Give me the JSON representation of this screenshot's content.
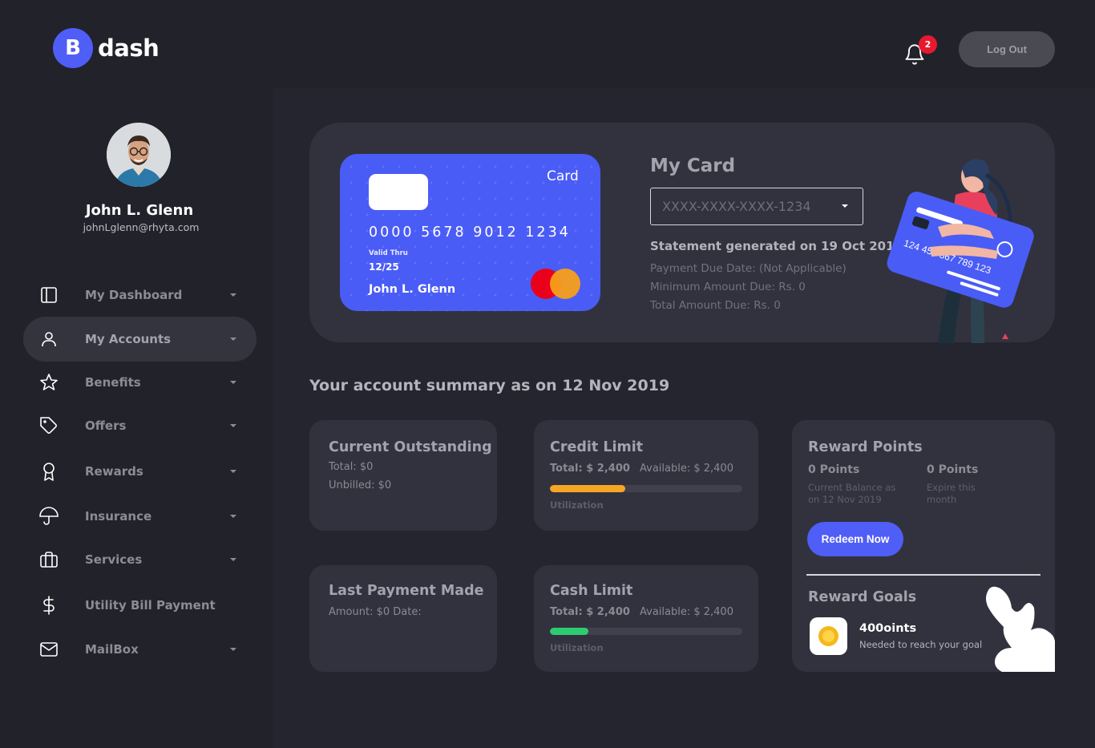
{
  "brand": {
    "mark": "B",
    "name": "dash"
  },
  "header": {
    "notification_count": "2",
    "logout_label": "Log Out"
  },
  "user": {
    "name": "John L. Glenn",
    "email": "johnLglenn@rhyta.com"
  },
  "sidebar": {
    "items": [
      {
        "label": "My Dashboard",
        "icon": "dashboard-icon",
        "has_caret": true,
        "active": false
      },
      {
        "label": "My Accounts",
        "icon": "user-icon",
        "has_caret": true,
        "active": true
      },
      {
        "label": "Benefits",
        "icon": "star-icon",
        "has_caret": true,
        "active": false
      },
      {
        "label": "Offers",
        "icon": "tag-icon",
        "has_caret": true,
        "active": false
      },
      {
        "label": "Rewards",
        "icon": "award-icon",
        "has_caret": true,
        "active": false
      },
      {
        "label": "Insurance",
        "icon": "umbrella-icon",
        "has_caret": true,
        "active": false
      },
      {
        "label": "Services",
        "icon": "briefcase-icon",
        "has_caret": true,
        "active": false
      },
      {
        "label": "Utility Bill Payment",
        "icon": "dollar-icon",
        "has_caret": false,
        "active": false
      },
      {
        "label": "MailBox",
        "icon": "mail-icon",
        "has_caret": true,
        "active": false
      }
    ]
  },
  "credit_card": {
    "label": "Card",
    "number": "0000 5678 9012 1234",
    "valid_thru_label": "Valid Thru",
    "valid_thru": "12/25",
    "holder": "John L. Glenn"
  },
  "my_card": {
    "title": "My Card",
    "select_value": "XXXX-XXXX-XXXX-1234",
    "statement": "Statement generated on 19 Oct 2019",
    "payment_due": "Payment Due Date: (Not Applicable)",
    "minimum_due": "Minimum Amount Due: Rs. 0",
    "total_due": "Total Amount Due: Rs. 0",
    "illustration_card_number": "124 456 367 789 123"
  },
  "summary": {
    "title": "Your account summary as on 12 Nov 2019",
    "current_outstanding": {
      "title": "Current Outstanding",
      "total": "Total: $0",
      "unbilled": "Unbilled: $0"
    },
    "credit_limit": {
      "title": "Credit Limit",
      "total": "Total: $ 2,400",
      "available": "Available: $ 2,400",
      "utilization_label": "Utilization",
      "utilization": 0.39,
      "bar_color": "#f5a623"
    },
    "last_payment": {
      "title": "Last Payment Made",
      "amount": "Amount: $0 Date:"
    },
    "cash_limit": {
      "title": "Cash Limit",
      "total": "Total: $ 2,400",
      "available": "Available: $ 2,400",
      "utilization_label": "Utilization",
      "utilization": 0.2,
      "bar_color": "#2ecc71"
    },
    "reward_points": {
      "title": "Reward Points",
      "balance_value": "0 Points",
      "balance_label_1": "Current Balance as",
      "balance_label_2": "on 12 Nov 2019",
      "expire_value": "0 Points",
      "expire_label_1": "Expire this",
      "expire_label_2": "month",
      "redeem_label": "Redeem Now"
    },
    "reward_goals": {
      "title": "Reward Goals",
      "goal_title": "400oints",
      "goal_sub": "Needed to reach your goal"
    }
  },
  "colors": {
    "accent": "#4f5ef7",
    "background": "#22222b",
    "panel": "#32323e",
    "danger": "#e6192f"
  }
}
